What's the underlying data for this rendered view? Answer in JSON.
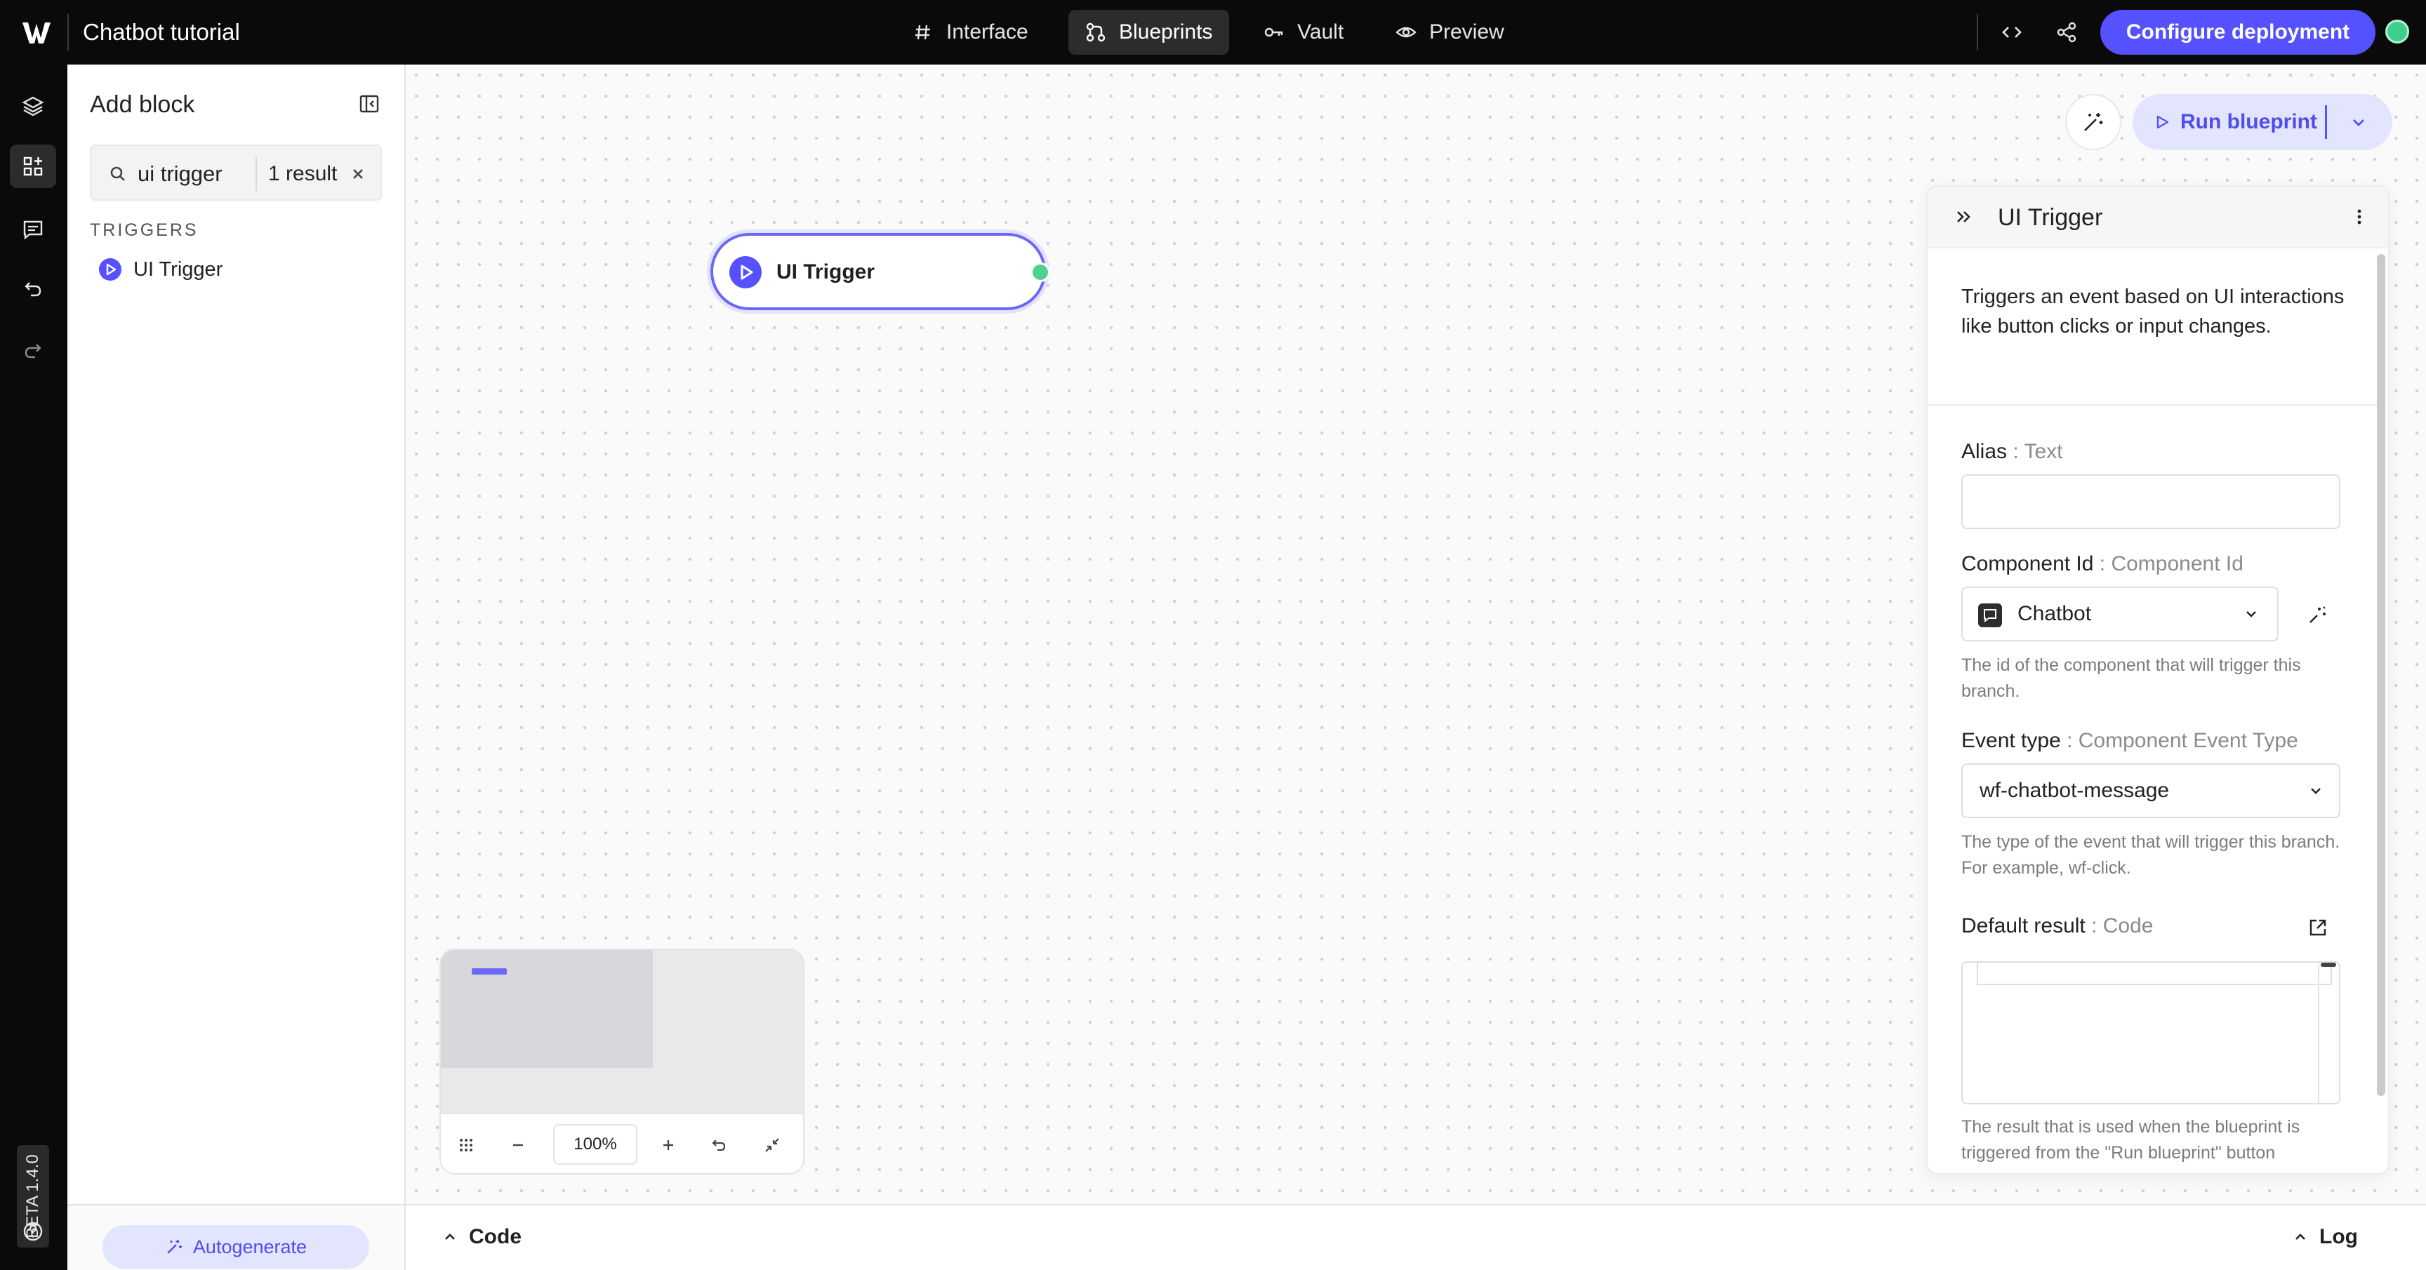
{
  "app": {
    "title": "Chatbot tutorial",
    "nav_tabs": [
      {
        "label": "Interface",
        "icon": "hash-icon",
        "active": false
      },
      {
        "label": "Blueprints",
        "icon": "blueprint-icon",
        "active": true
      },
      {
        "label": "Vault",
        "icon": "key-icon",
        "active": false
      },
      {
        "label": "Preview",
        "icon": "eye-icon",
        "active": false
      }
    ],
    "deploy_label": "Configure deployment",
    "version_badge": "BETA 1.4.0",
    "colors": {
      "accent": "#5551ff",
      "accent_soft": "#e3e5ff",
      "status": "#3ecf8e"
    }
  },
  "rail": {
    "items": [
      "layers-icon",
      "add-block-icon",
      "chat-icon",
      "undo-icon",
      "redo-icon",
      "help-icon"
    ],
    "active": "add-block-icon"
  },
  "add_block": {
    "title": "Add block",
    "search": {
      "value": "ui trigger",
      "result_count": "1 result"
    },
    "section": "TRIGGERS",
    "items": [
      {
        "label": "UI Trigger",
        "icon": "play-circle-icon"
      }
    ],
    "autogenerate_label": "Autogenerate"
  },
  "canvas": {
    "node": {
      "label": "UI Trigger"
    },
    "run_label": "Run blueprint",
    "zoom": "100%"
  },
  "settings": {
    "title": "UI Trigger",
    "description": "Triggers an event based on UI interactions like button clicks or input changes.",
    "alias": {
      "label": "Alias",
      "type": " : Text",
      "value": ""
    },
    "component_id": {
      "label": "Component Id",
      "type": " : Component Id",
      "value": "Chatbot",
      "help": "The id of the component that will trigger this branch."
    },
    "event_type": {
      "label": "Event type",
      "type": " : Component Event Type",
      "value": "wf-chatbot-message",
      "help": "The type of the event that will trigger this branch. For example, wf-click."
    },
    "default_result": {
      "label": "Default result",
      "type": " : Code",
      "help": "The result that is used when the blueprint is triggered from the \"Run blueprint\" button"
    }
  },
  "bottom": {
    "code_label": "Code",
    "log_label": "Log"
  }
}
